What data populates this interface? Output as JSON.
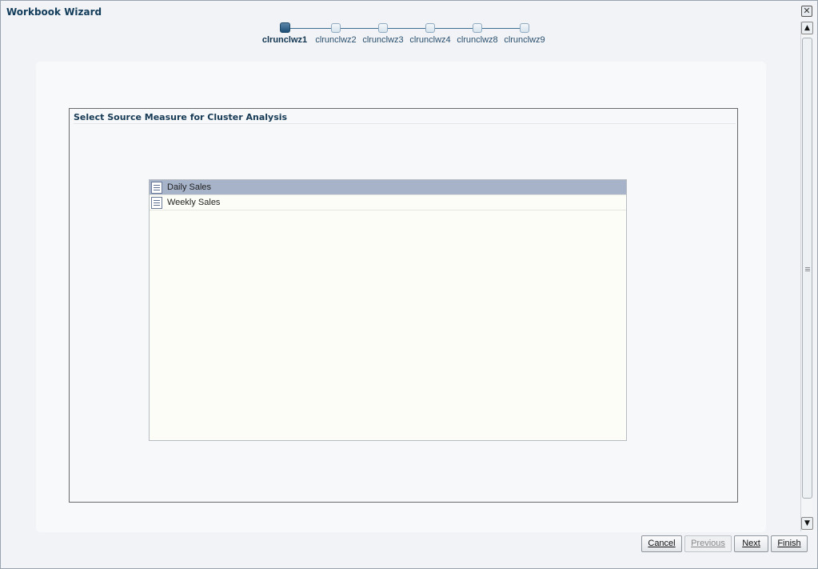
{
  "window": {
    "title": "Workbook Wizard",
    "close_label": "✕"
  },
  "train": {
    "steps": [
      {
        "label": "clrunclwz1",
        "active": true
      },
      {
        "label": "clrunclwz2",
        "active": false
      },
      {
        "label": "clrunclwz3",
        "active": false
      },
      {
        "label": "clrunclwz4",
        "active": false
      },
      {
        "label": "clrunclwz8",
        "active": false
      },
      {
        "label": "clrunclwz9",
        "active": false
      }
    ]
  },
  "section": {
    "title": "Select Source Measure for Cluster Analysis"
  },
  "list": {
    "items": [
      {
        "label": "Daily Sales",
        "selected": true,
        "icon": "document-icon"
      },
      {
        "label": "Weekly Sales",
        "selected": false,
        "icon": "document-icon"
      }
    ]
  },
  "scrollbar": {
    "up_label": "▲",
    "down_label": "▼"
  },
  "buttons": {
    "cancel": "Cancel",
    "previous": "Previous",
    "next": "Next",
    "finish": "Finish"
  },
  "colors": {
    "title_text": "#123c5a",
    "selected_row": "#a6b3c9",
    "active_step": "#1f4f78"
  }
}
